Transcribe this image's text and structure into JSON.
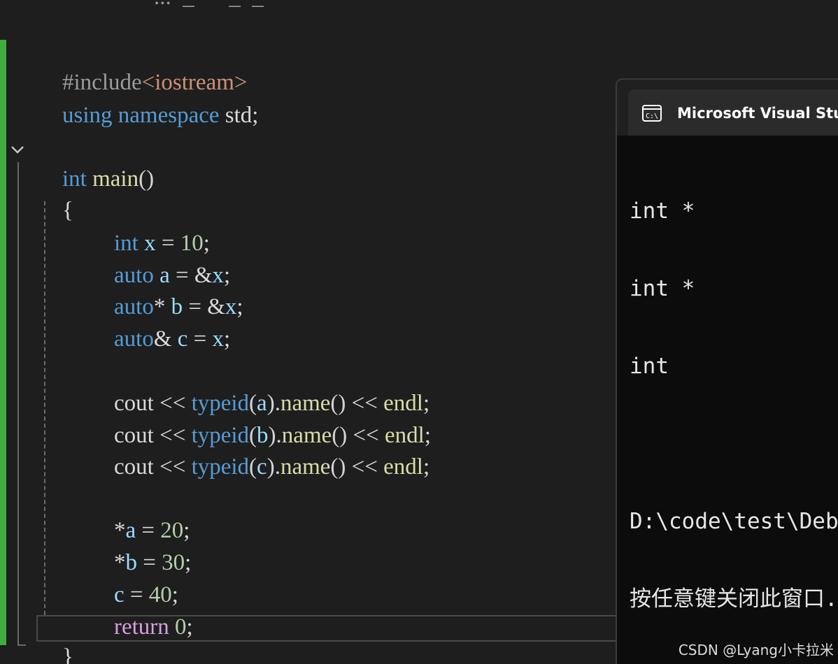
{
  "editor": {
    "top_fragment": "...  _      _  _",
    "lines": {
      "l1": {
        "hash_include": "#include",
        "header": "<iostream>"
      },
      "l2": {
        "using": "using",
        "namespace": "namespace",
        "std": "std",
        "semi": ";"
      },
      "l3": {
        "int": "int",
        "main": "main",
        "parens": "()"
      },
      "l4": {
        "brace": "{"
      },
      "l5": {
        "int": "int",
        "x": "x",
        "eq": " = ",
        "val": "10",
        "semi": ";"
      },
      "l6": {
        "auto": "auto",
        "a": "a",
        "eq": " = &",
        "x": "x",
        "semi": ";"
      },
      "l7": {
        "auto": "auto",
        "star": "*",
        "b": "b",
        "eq": " = &",
        "x": "x",
        "semi": ";"
      },
      "l8": {
        "auto": "auto",
        "amp": "&",
        "c": "c",
        "eq": " = ",
        "x": "x",
        "semi": ";"
      },
      "l9": {
        "cout": "cout",
        "op1": " << ",
        "typeid": "typeid",
        "p1": "(",
        "arg": "a",
        "p2": ").",
        "name": "name",
        "p3": "()",
        "op2": " << ",
        "endl": "endl",
        "semi": ";"
      },
      "l10": {
        "cout": "cout",
        "op1": " << ",
        "typeid": "typeid",
        "p1": "(",
        "arg": "b",
        "p2": ").",
        "name": "name",
        "p3": "()",
        "op2": " << ",
        "endl": "endl",
        "semi": ";"
      },
      "l11": {
        "cout": "cout",
        "op1": " << ",
        "typeid": "typeid",
        "p1": "(",
        "arg": "c",
        "p2": ").",
        "name": "name",
        "p3": "()",
        "op2": " << ",
        "endl": "endl",
        "semi": ";"
      },
      "l12": {
        "star": "*",
        "a": "a",
        "eq": " = ",
        "val": "20",
        "semi": ";"
      },
      "l13": {
        "star": "*",
        "b": "b",
        "eq": " = ",
        "val": "30",
        "semi": ";"
      },
      "l14": {
        "c": "c",
        "eq": " = ",
        "val": "40",
        "semi": ";"
      },
      "l15": {
        "ret": "return",
        "val": "0",
        "semi": ";"
      },
      "l16": {
        "brace": "}"
      }
    }
  },
  "console": {
    "icon": "console-icon",
    "title": "Microsoft Visual Studio 调试控制台",
    "output": [
      "int *",
      "int *",
      "int",
      "",
      "D:\\code\\test\\Debug\\test.exe",
      "按任意键关闭此窗口. . ."
    ]
  },
  "watermark": "CSDN @Lyang小卡拉米",
  "colors": {
    "editor_bg": "#1e1e1e",
    "console_bg": "#0c0c0c",
    "change_bar": "#3fae3f",
    "keyword": "#569cd6",
    "variable": "#9cdcfe",
    "function": "#dcdcaa",
    "number": "#b5cea8",
    "string": "#ce9178",
    "control_flow": "#d8a0df"
  }
}
